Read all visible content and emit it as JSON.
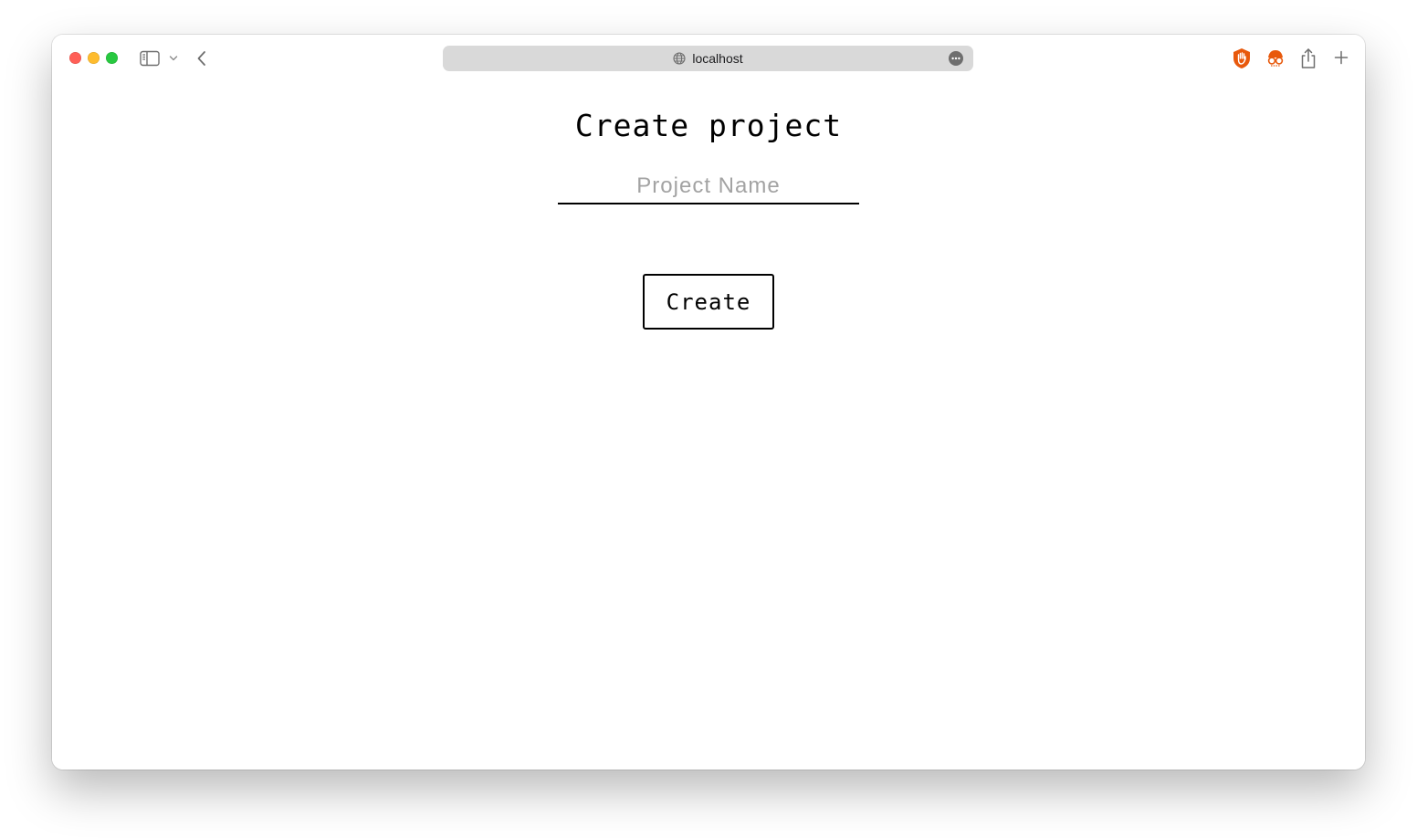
{
  "browser": {
    "url": "localhost",
    "icons": {
      "sidebar": "sidebar-icon",
      "chevron": "chevron-down-icon",
      "back": "back-arrow-icon",
      "globe": "globe-icon",
      "more": "more-icon",
      "extension_1": "hand-stop-extension-icon",
      "extension_2": "incognito-glasses-extension-icon",
      "share": "share-icon",
      "new_tab": "plus-icon"
    },
    "colors": {
      "close": "#ff5f57",
      "minimize": "#febc2e",
      "maximize": "#28c840",
      "extension_accent": "#e8590c"
    }
  },
  "page": {
    "title": "Create project",
    "project_name": {
      "value": "",
      "placeholder": "Project Name"
    },
    "create_button": "Create"
  }
}
